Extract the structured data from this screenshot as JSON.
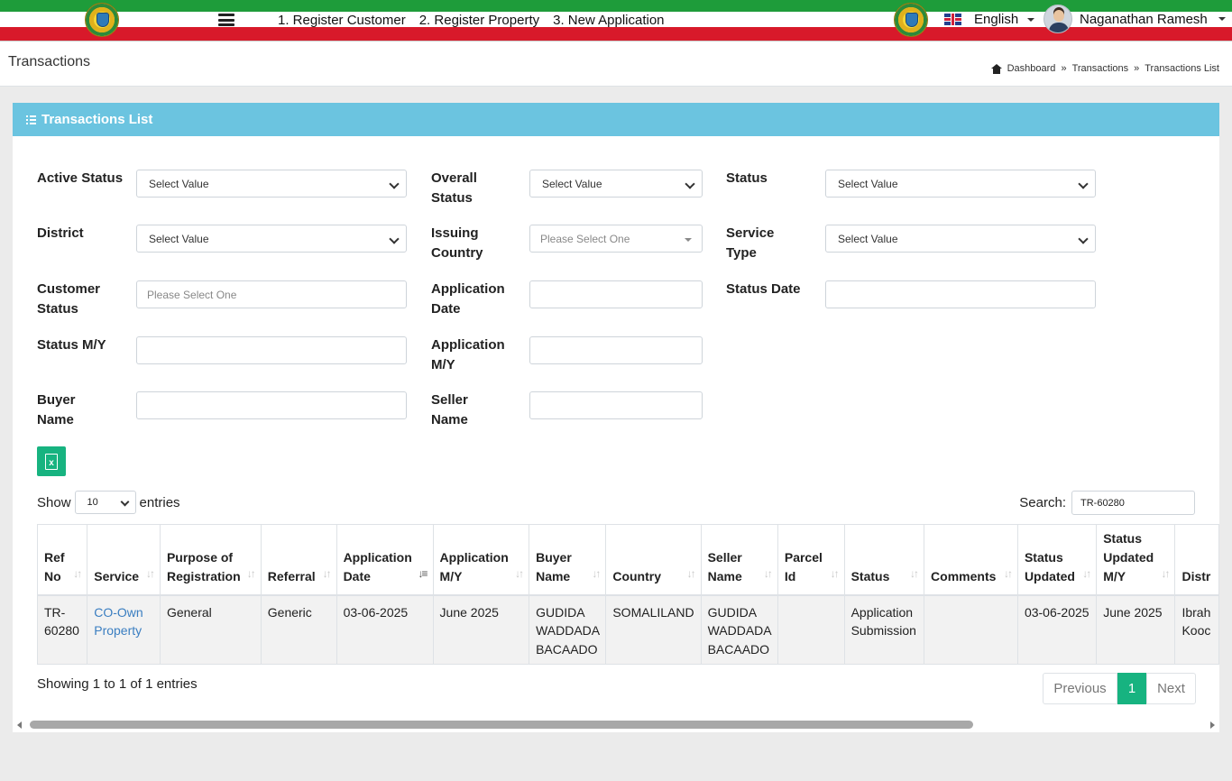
{
  "header": {
    "nav": [
      "1. Register Customer",
      "2. Register Property",
      "3. New Application"
    ],
    "language": "English",
    "user_name": "Naganathan Ramesh"
  },
  "page": {
    "title": "Transactions",
    "breadcrumb": [
      "Dashboard",
      "Transactions",
      "Transactions List"
    ],
    "breadcrumb_sep": "»"
  },
  "card": {
    "title": "Transactions List"
  },
  "filters": {
    "active_status": {
      "label": "Active Status",
      "value": "Select Value"
    },
    "overall_status": {
      "label": "Overall Status",
      "value": "Select Value"
    },
    "status": {
      "label": "Status",
      "value": "Select Value"
    },
    "district": {
      "label": "District",
      "value": "Select Value"
    },
    "issuing_country": {
      "label": "Issuing Country",
      "placeholder": "Please Select One"
    },
    "service_type": {
      "label": "Service Type",
      "value": "Select Value"
    },
    "customer_status": {
      "label": "Customer Status",
      "placeholder": "Please Select One"
    },
    "application_date": {
      "label": "Application Date",
      "value": ""
    },
    "status_date": {
      "label": "Status Date",
      "value": ""
    },
    "status_my": {
      "label": "Status M/Y",
      "value": ""
    },
    "application_my": {
      "label": "Application M/Y",
      "value": ""
    },
    "buyer_name": {
      "label": "Buyer Name",
      "value": ""
    },
    "seller_name": {
      "label": "Seller Name",
      "value": ""
    }
  },
  "table_controls": {
    "show_label": "Show",
    "entries_label": "entries",
    "page_length": "10",
    "search_label": "Search:",
    "search_value": "TR-60280"
  },
  "table": {
    "columns": [
      "Ref No",
      "Service",
      "Purpose of Registration",
      "Referral",
      "Application Date",
      "Application M/Y",
      "Buyer Name",
      "Country",
      "Seller Name",
      "Parcel Id",
      "Status",
      "Comments",
      "Status Updated",
      "Status Updated M/Y",
      "Distr"
    ],
    "rows": [
      {
        "ref_no": "TR-60280",
        "service": "CO-Own Property",
        "purpose": "General",
        "referral": "Generic",
        "application_date": "03-06-2025",
        "application_my": "June 2025",
        "buyer_name": "GUDIDA WADDADA BACAADO",
        "country": "SOMALILAND",
        "seller_name": "GUDIDA WADDADA BACAADO",
        "parcel_id": "",
        "status": "Application Submission",
        "comments": "",
        "status_updated": "03-06-2025",
        "status_updated_my": "June 2025",
        "district": "Ibrah Kooc"
      }
    ]
  },
  "footer": {
    "info": "Showing 1 to 1 of 1 entries",
    "previous": "Previous",
    "current_page": "1",
    "next": "Next"
  },
  "colors": {
    "header_green": "#1e9c3a",
    "header_red": "#d8192a",
    "card_header": "#6bc4e0",
    "accent_green": "#17b380",
    "link": "#3a7ec1"
  }
}
